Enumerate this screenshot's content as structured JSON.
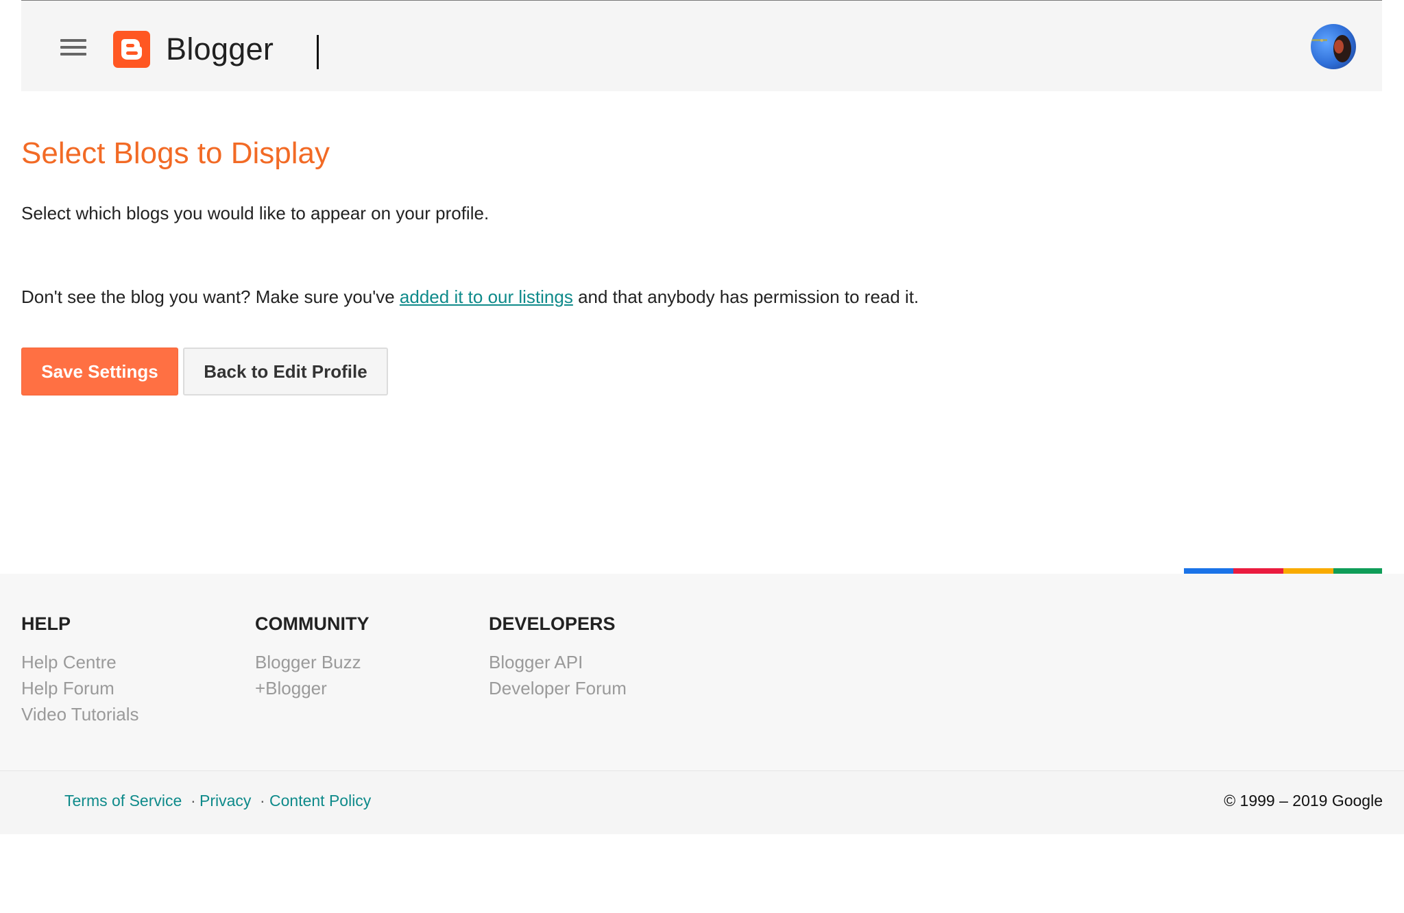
{
  "header": {
    "brand": "Blogger",
    "brand_color": "#ff5722"
  },
  "main": {
    "title": "Select Blogs to Display",
    "description": "Select which blogs you would like to appear on your profile.",
    "note_before": "Don't see the blog you want? Make sure you've ",
    "note_link": "added it to our listings",
    "note_after": " and that anybody has permission to read it.",
    "save_button": "Save Settings",
    "back_button": "Back to Edit Profile"
  },
  "footer": {
    "accent_colors": [
      "#1a73e8",
      "#ea1c3f",
      "#f9ab00",
      "#0f9d58"
    ],
    "columns": [
      {
        "heading": "HELP",
        "links": [
          "Help Centre",
          "Help Forum",
          "Video Tutorials"
        ]
      },
      {
        "heading": "COMMUNITY",
        "links": [
          "Blogger Buzz",
          "+Blogger"
        ]
      },
      {
        "heading": "DEVELOPERS",
        "links": [
          "Blogger API",
          "Developer Forum"
        ]
      }
    ],
    "legal": [
      "Terms of Service",
      "Privacy",
      "Content Policy"
    ],
    "separator": "·",
    "copyright": "© 1999 – 2019 Google"
  }
}
